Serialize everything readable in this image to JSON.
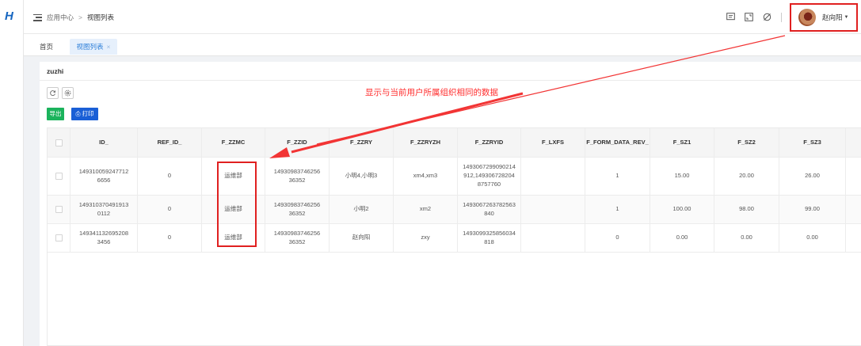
{
  "logo_text": "H",
  "breadcrumb": {
    "root": "应用中心",
    "separator": ">",
    "current": "视图列表"
  },
  "user": {
    "name": "赵向阳"
  },
  "tabs": [
    {
      "label": "首页"
    },
    {
      "label": "视图列表",
      "close": "×"
    }
  ],
  "panel_title": "zuzhi",
  "toolbar": {
    "export_label": "导出",
    "print_label": "打印"
  },
  "annotation": "显示与当前用户所属组织相同的数据",
  "table": {
    "columns": [
      "ID_",
      "REF_ID_",
      "F_ZZMC",
      "F_ZZID",
      "F_ZZRY",
      "F_ZZRYZH",
      "F_ZZRYID",
      "F_LXFS",
      "F_FORM_DATA_REV_",
      "F_SZ1",
      "F_SZ2",
      "F_SZ3"
    ],
    "rows": [
      [
        "1493100592477126656",
        "0",
        "运维部",
        "1493098374625636352",
        "小明4,小明3",
        "xm4,xm3",
        "1493067299090214912,1493067282048757760",
        "",
        "1",
        "15.00",
        "20.00",
        "26.00"
      ],
      [
        "1493103704919130112",
        "0",
        "运维部",
        "1493098374625636352",
        "小明2",
        "xm2",
        "1493067263782563840",
        "",
        "1",
        "100.00",
        "98.00",
        "99.00"
      ],
      [
        "1493411326952083456",
        "0",
        "运维部",
        "1493098374625636352",
        "赵向阳",
        "zxy",
        "1493099325856034818",
        "",
        "0",
        "0.00",
        "0.00",
        "0.00"
      ]
    ]
  },
  "colors": {
    "accent": "#1a5fd6",
    "export_green": "#1bb35c",
    "annotation_red": "#ff2d2d",
    "tab_active": "#2d7fd9"
  }
}
